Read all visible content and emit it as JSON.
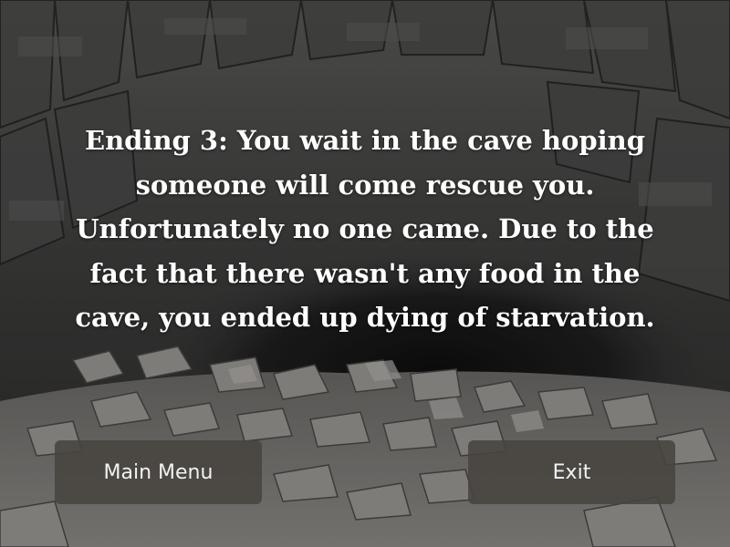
{
  "story": {
    "ending_text": "Ending 3: You wait in the cave hoping someone will come rescue you. Unfortunately no one came. Due to the fact that there wasn't any food in the cave, you ended up dying of starvation."
  },
  "buttons": {
    "main_menu_label": "Main Menu",
    "exit_label": "Exit"
  },
  "colors": {
    "text": "#ffffff",
    "button_bg": "#484440",
    "button_text": "#f2f2f2"
  }
}
